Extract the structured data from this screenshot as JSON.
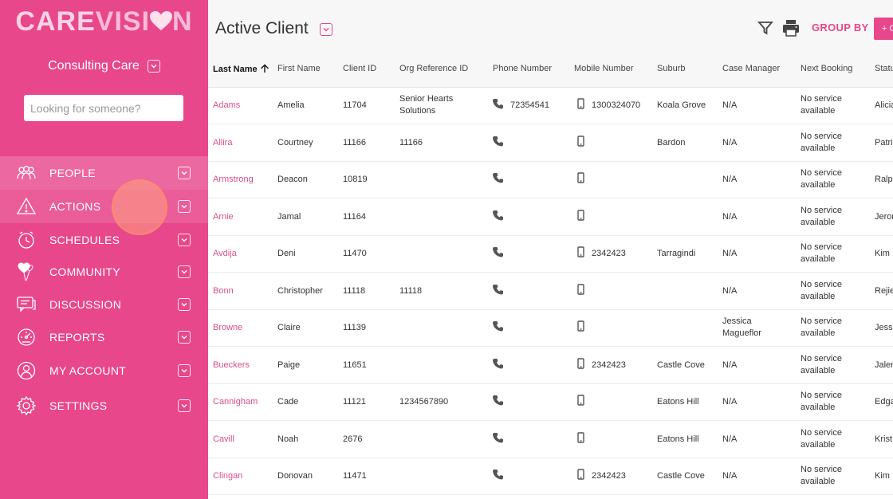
{
  "sidebar": {
    "logo": {
      "part1": "CARE",
      "part2": "VISI",
      "part3": "N"
    },
    "org_name": "Consulting Care",
    "search_placeholder": "Looking for someone?",
    "items": [
      {
        "label": "PEOPLE",
        "icon": "people-icon"
      },
      {
        "label": "ACTIONS",
        "icon": "warning-icon"
      },
      {
        "label": "SCHEDULES",
        "icon": "clock-icon"
      },
      {
        "label": "COMMUNITY",
        "icon": "heart-balloon-icon"
      },
      {
        "label": "DISCUSSION",
        "icon": "chat-icon"
      },
      {
        "label": "REPORTS",
        "icon": "gauge-icon"
      },
      {
        "label": "MY ACCOUNT",
        "icon": "user-icon"
      },
      {
        "label": "SETTINGS",
        "icon": "gear-icon"
      }
    ]
  },
  "header": {
    "title": "Active Client",
    "group_by": "GROUP BY",
    "add_label": "+ C"
  },
  "table": {
    "columns": [
      "Last Name",
      "First Name",
      "Client ID",
      "Org Reference ID",
      "Phone Number",
      "Mobile Number",
      "Suburb",
      "Case Manager",
      "Next Booking",
      "Status"
    ],
    "rows": [
      {
        "last": "Adams",
        "first": "Amelia",
        "id": "11704",
        "org": "Senior Hearts Solutions",
        "phone": "72354541",
        "mobile": "1300324070",
        "suburb": "Koala Grove",
        "cm": "N/A",
        "nb": "No service available",
        "status": "Alicia"
      },
      {
        "last": "Allira",
        "first": "Courtney",
        "id": "11166",
        "org": "11166",
        "phone": "",
        "mobile": "",
        "suburb": "Bardon",
        "cm": "N/A",
        "nb": "No service available",
        "status": "Patri"
      },
      {
        "last": "Armstrong",
        "first": "Deacon",
        "id": "10819",
        "org": "",
        "phone": "",
        "mobile": "",
        "suburb": "",
        "cm": "N/A",
        "nb": "No service available",
        "status": "Ralp"
      },
      {
        "last": "Arnie",
        "first": "Jamal",
        "id": "11164",
        "org": "",
        "phone": "",
        "mobile": "",
        "suburb": "",
        "cm": "N/A",
        "nb": "No service available",
        "status": "Jeron"
      },
      {
        "last": "Avdija",
        "first": "Deni",
        "id": "11470",
        "org": "",
        "phone": "",
        "mobile": "2342423",
        "suburb": "Tarragindi",
        "cm": "N/A",
        "nb": "No service available",
        "status": "Kim"
      },
      {
        "last": "Bonn",
        "first": "Christopher",
        "id": "11118",
        "org": "11118",
        "phone": "",
        "mobile": "",
        "suburb": "",
        "cm": "N/A",
        "nb": "No service available",
        "status": "Rejie"
      },
      {
        "last": "Browne",
        "first": "Claire",
        "id": "11139",
        "org": "",
        "phone": "",
        "mobile": "",
        "suburb": "",
        "cm": "Jessica Magueflor",
        "nb": "No service available",
        "status": "Jessi"
      },
      {
        "last": "Bueckers",
        "first": "Paige",
        "id": "11651",
        "org": "",
        "phone": "",
        "mobile": "2342423",
        "suburb": "Castle Cove",
        "cm": "N/A",
        "nb": "No service available",
        "status": "Jalen"
      },
      {
        "last": "Cannigham",
        "first": "Cade",
        "id": "11121",
        "org": "1234567890",
        "phone": "",
        "mobile": "",
        "suburb": "Eatons Hill",
        "cm": "N/A",
        "nb": "No service available",
        "status": "Edga"
      },
      {
        "last": "Cavill",
        "first": "Noah",
        "id": "2676",
        "org": "",
        "phone": "",
        "mobile": "",
        "suburb": "Eatons Hill",
        "cm": "N/A",
        "nb": "No service available",
        "status": "Krist"
      },
      {
        "last": "Clingan",
        "first": "Donovan",
        "id": "11471",
        "org": "",
        "phone": "",
        "mobile": "2342423",
        "suburb": "Castle Cove",
        "cm": "N/A",
        "nb": "No service available",
        "status": "Kim"
      }
    ]
  },
  "colors": {
    "brand": "#e8478b",
    "link": "#d94f8a"
  }
}
